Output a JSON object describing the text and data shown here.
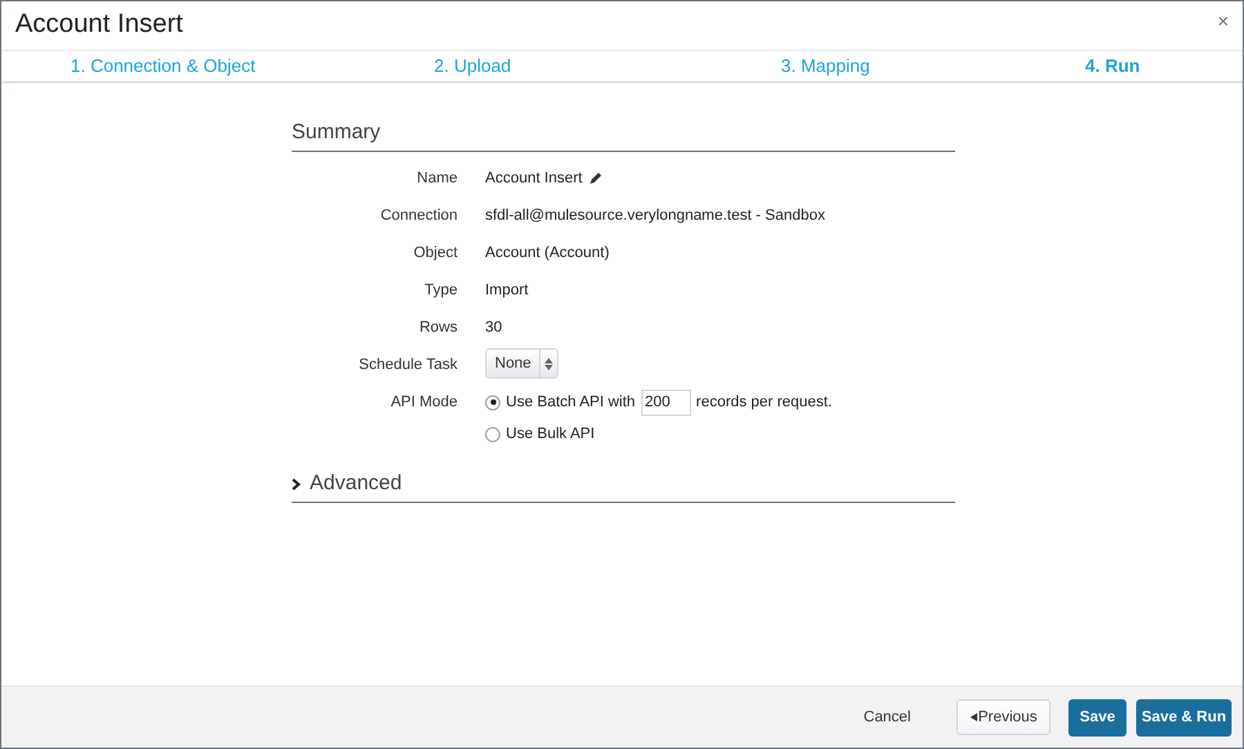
{
  "window": {
    "title": "Account Insert",
    "close": "×"
  },
  "steps": [
    {
      "label": "1. Connection & Object",
      "selected": false
    },
    {
      "label": "2. Upload",
      "selected": false
    },
    {
      "label": "3. Mapping",
      "selected": false
    },
    {
      "label": "4. Run",
      "selected": true
    }
  ],
  "summary": {
    "heading": "Summary",
    "fields": [
      {
        "kind": "text",
        "label": "Name",
        "value": "Account Insert",
        "editable": true
      },
      {
        "kind": "text",
        "label": "Connection",
        "value": "sfdl-all@mulesource.verylongname.test - Sandbox",
        "editable": false
      },
      {
        "kind": "text",
        "label": "Object",
        "value": "Account (Account)",
        "editable": false
      },
      {
        "kind": "text",
        "label": "Type",
        "value": "Import",
        "editable": false
      },
      {
        "kind": "text",
        "label": "Rows",
        "value": "30",
        "editable": false
      },
      {
        "kind": "select",
        "label": "Schedule Task",
        "value": "None"
      },
      {
        "kind": "radio",
        "label": "API Mode",
        "options": [
          {
            "before": "Use Batch API with",
            "input": "200",
            "after": "records per request.",
            "selected": true
          },
          {
            "before": "Use Bulk API",
            "selected": false
          }
        ]
      }
    ]
  },
  "advanced": {
    "heading": "Advanced",
    "expanded": false
  },
  "footer": {
    "cancel": "Cancel",
    "previous": "Previous",
    "save": "Save",
    "save_run": "Save & Run"
  }
}
